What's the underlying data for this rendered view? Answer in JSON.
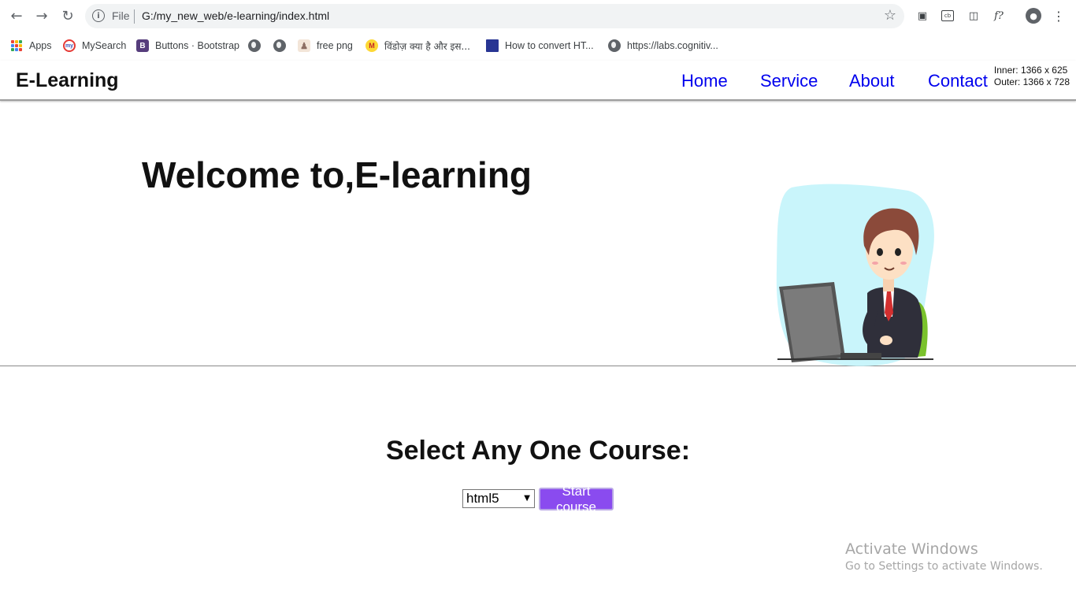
{
  "browser": {
    "address": {
      "scheme_label": "File",
      "url": "G:/my_new_web/e-learning/index.html"
    },
    "bookmarks": [
      {
        "label": "Apps",
        "icon": "apps-grid-icon"
      },
      {
        "label": "MySearch",
        "icon": "mysearch-icon"
      },
      {
        "label": "Buttons · Bootstrap",
        "icon": "bootstrap-icon"
      },
      {
        "label": "",
        "icon": "globe-icon"
      },
      {
        "label": "",
        "icon": "globe-icon"
      },
      {
        "label": "free png",
        "icon": "png-icon"
      },
      {
        "label": "विंडोज़ क्या है और इस...",
        "icon": "m-icon"
      },
      {
        "label": "How to convert HT...",
        "icon": "page-icon"
      },
      {
        "label": "https://labs.cognitiv...",
        "icon": "globe-icon"
      }
    ]
  },
  "site": {
    "brand": "E-Learning",
    "menu": [
      "Home",
      "Service",
      "About",
      "Contact"
    ],
    "dims": {
      "inner": "Inner: 1366 x 625",
      "outer": "Outer: 1366 x 728"
    },
    "hero_title": "Welcome to,E-learning",
    "course_title": "Select Any One Course:",
    "course_selected": "html5",
    "start_button": "Start course",
    "link_color": "#0000ee",
    "button_color": "#8a4bef"
  },
  "watermark": {
    "line1": "Activate Windows",
    "line2": "Go to Settings to activate Windows."
  }
}
